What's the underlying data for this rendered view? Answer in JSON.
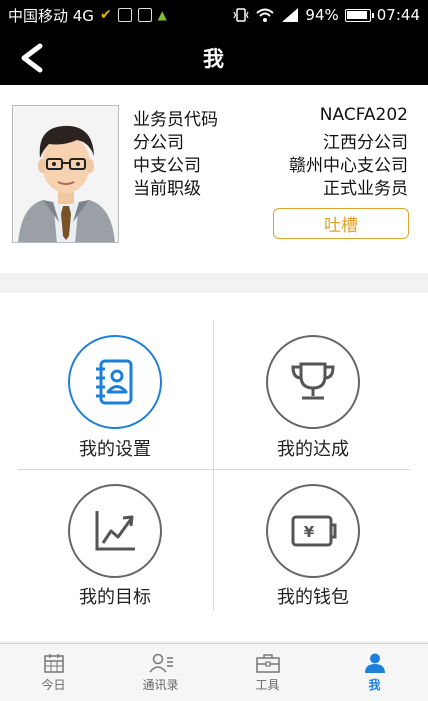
{
  "status_bar": {
    "carrier": "中国移动 4G",
    "battery": "94%",
    "time": "07:44"
  },
  "header": {
    "title": "我"
  },
  "profile": {
    "rows": [
      {
        "label": "业务员代码",
        "value": "NACFA202"
      },
      {
        "label": "分公司",
        "value": "江西分公司"
      },
      {
        "label": "中支公司",
        "value": "赣州中心支公司"
      },
      {
        "label": "当前职级",
        "value": "正式业务员"
      }
    ],
    "feedback_label": "吐槽"
  },
  "menu": {
    "items": [
      {
        "label": "我的设置",
        "icon": "address-book-icon"
      },
      {
        "label": "我的达成",
        "icon": "trophy-icon"
      },
      {
        "label": "我的目标",
        "icon": "growth-chart-icon"
      },
      {
        "label": "我的钱包",
        "icon": "wallet-icon"
      }
    ]
  },
  "nav": {
    "items": [
      {
        "label": "今日",
        "icon": "calendar-icon"
      },
      {
        "label": "通讯录",
        "icon": "contacts-icon"
      },
      {
        "label": "工具",
        "icon": "toolbox-icon"
      },
      {
        "label": "我",
        "icon": "person-icon"
      }
    ],
    "active_index": 3
  },
  "colors": {
    "accent": "#1e7fd8",
    "feedback": "#e0a22b",
    "header_bg": "#000000"
  }
}
